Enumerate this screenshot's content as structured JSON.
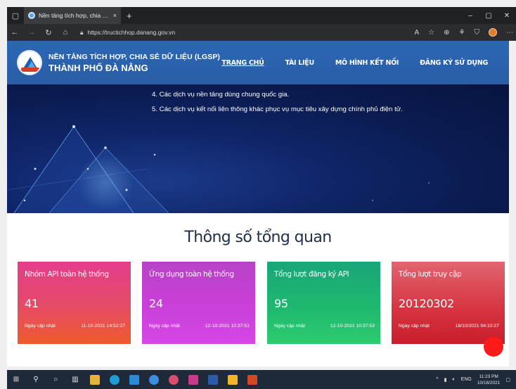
{
  "browser": {
    "tab_title": "Nền tảng tích hợp, chia sẻ dữ liệ",
    "tab_close": "×",
    "new_tab": "+",
    "url": "https://tructichhop.danang.gov.vn",
    "window_controls": [
      "–",
      "▢",
      "✕"
    ],
    "nav_icons": [
      "back-icon",
      "forward-icon",
      "refresh-icon",
      "home-icon"
    ],
    "toolbar_icons": [
      "read-aloud-icon",
      "favorites-icon",
      "collections-icon",
      "extension-icon",
      "shield-icon",
      "profile-icon",
      "more-icon"
    ]
  },
  "site": {
    "brand_line1": "NỀN TẢNG TÍCH HỢP, CHIA SẺ DỮ LIỆU (LGSP)",
    "brand_line2": "THÀNH PHỐ ĐÀ NẴNG",
    "menu": [
      {
        "label": "TRANG CHỦ",
        "active": true
      },
      {
        "label": "TÀI LIỆU",
        "active": false
      },
      {
        "label": "MÔ HÌNH KẾT NỐI",
        "active": false
      },
      {
        "label": "ĐĂNG KÝ SỬ DỤNG",
        "active": false
      }
    ]
  },
  "hero": {
    "lines": [
      "4. Các dịch vụ nền tảng dùng chung quốc gia.",
      "5. Các dịch vụ kết nối liên thông khác phục vụ mục tiêu xây dựng chính phủ điện tử."
    ]
  },
  "stats": {
    "title": "Thông số tổng quan",
    "cards": [
      {
        "title": "Nhóm API toàn hệ thống",
        "value": "41",
        "updated_label": "Ngày cập nhật",
        "updated": "11-10-2021 14:52:37"
      },
      {
        "title": "Ứng dụng toàn hệ thống",
        "value": "24",
        "updated_label": "Ngày cập nhật",
        "updated": "12-10-2021 10:37:51"
      },
      {
        "title": "Tổng lượt đăng ký API",
        "value": "95",
        "updated_label": "Ngày cập nhật",
        "updated": "12-10-2021 10:37:53"
      },
      {
        "title": "Tổng lượt truy cập",
        "value": "20120302",
        "updated_label": "Ngày cập nhật",
        "updated": "18/10/2021 04:10:27"
      }
    ]
  },
  "taskbar": {
    "lang": "ENG",
    "time": "11:23 PM",
    "date": "10/18/2021",
    "tray": "^"
  }
}
